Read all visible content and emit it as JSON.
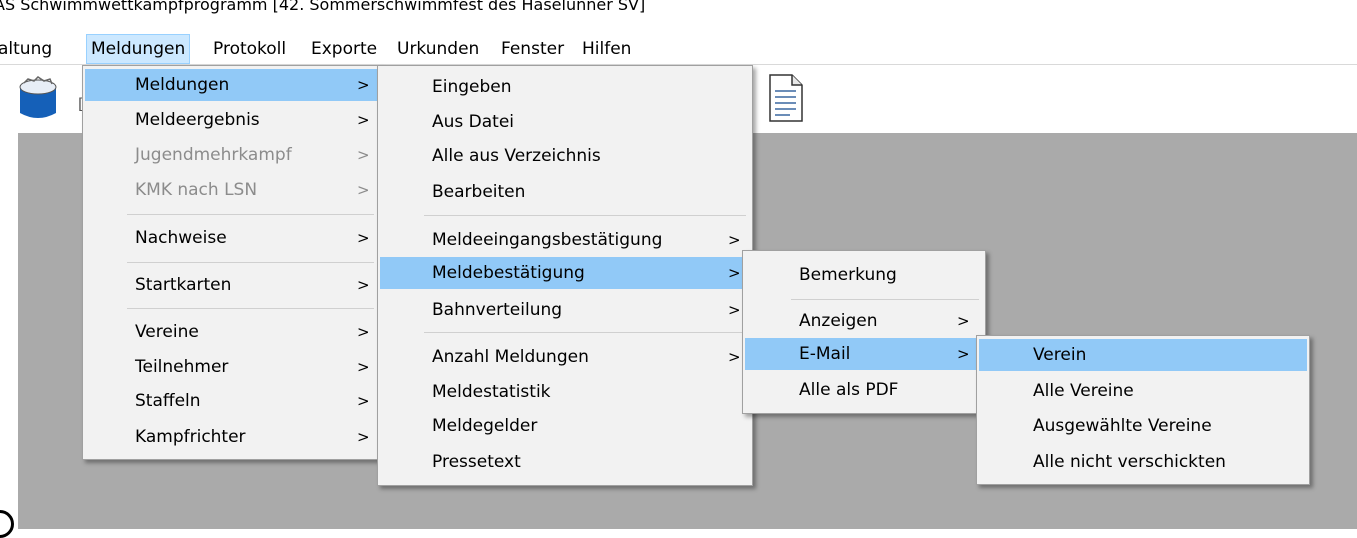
{
  "window": {
    "title": "AS Schwimmwettkampfprogramm [42. Sommerschwimmfest des Haselünner SV]"
  },
  "menubar": [
    "altung",
    "Meldungen",
    "Protokoll",
    "Exporte",
    "Urkunden",
    "Fenster",
    "Hilfen"
  ],
  "menu_meldungen": [
    {
      "label": "Meldungen",
      "arrow": ">"
    },
    {
      "label": "Meldeergebnis",
      "arrow": ">"
    },
    {
      "label": "Jugendmehrkampf",
      "arrow": ">"
    },
    {
      "label": "KMK nach LSN",
      "arrow": ">"
    },
    {
      "label": "Nachweise",
      "arrow": ">"
    },
    {
      "label": "Startkarten",
      "arrow": ">"
    },
    {
      "label": "Vereine",
      "arrow": ">"
    },
    {
      "label": "Teilnehmer",
      "arrow": ">"
    },
    {
      "label": "Staffeln",
      "arrow": ">"
    },
    {
      "label": "Kampfrichter",
      "arrow": ">"
    }
  ],
  "menu_sub": [
    {
      "label": "Eingeben"
    },
    {
      "label": "Aus Datei"
    },
    {
      "label": "Alle aus Verzeichnis"
    },
    {
      "label": "Bearbeiten"
    },
    {
      "label": "Meldeeingangsbestätigung",
      "arrow": ">"
    },
    {
      "label": "Meldebestätigung",
      "arrow": ">"
    },
    {
      "label": "Bahnverteilung",
      "arrow": ">"
    },
    {
      "label": "Anzahl Meldungen",
      "arrow": ">"
    },
    {
      "label": "Meldestatistik"
    },
    {
      "label": "Meldegelder"
    },
    {
      "label": "Pressetext"
    }
  ],
  "menu_bestaetigung": [
    {
      "label": "Bemerkung"
    },
    {
      "label": "Anzeigen",
      "arrow": ">"
    },
    {
      "label": "E-Mail",
      "arrow": ">"
    },
    {
      "label": "Alle als PDF"
    }
  ],
  "menu_email": [
    {
      "label": "Verein"
    },
    {
      "label": "Alle Vereine"
    },
    {
      "label": "Ausgewählte Vereine"
    },
    {
      "label": "Alle nicht verschickten"
    }
  ],
  "toolbar": {
    "partial_label": "["
  },
  "colors": {
    "highlight": "#91c9f7",
    "menubar_active": "#cce8ff",
    "workspace": "#aaaaaa"
  }
}
